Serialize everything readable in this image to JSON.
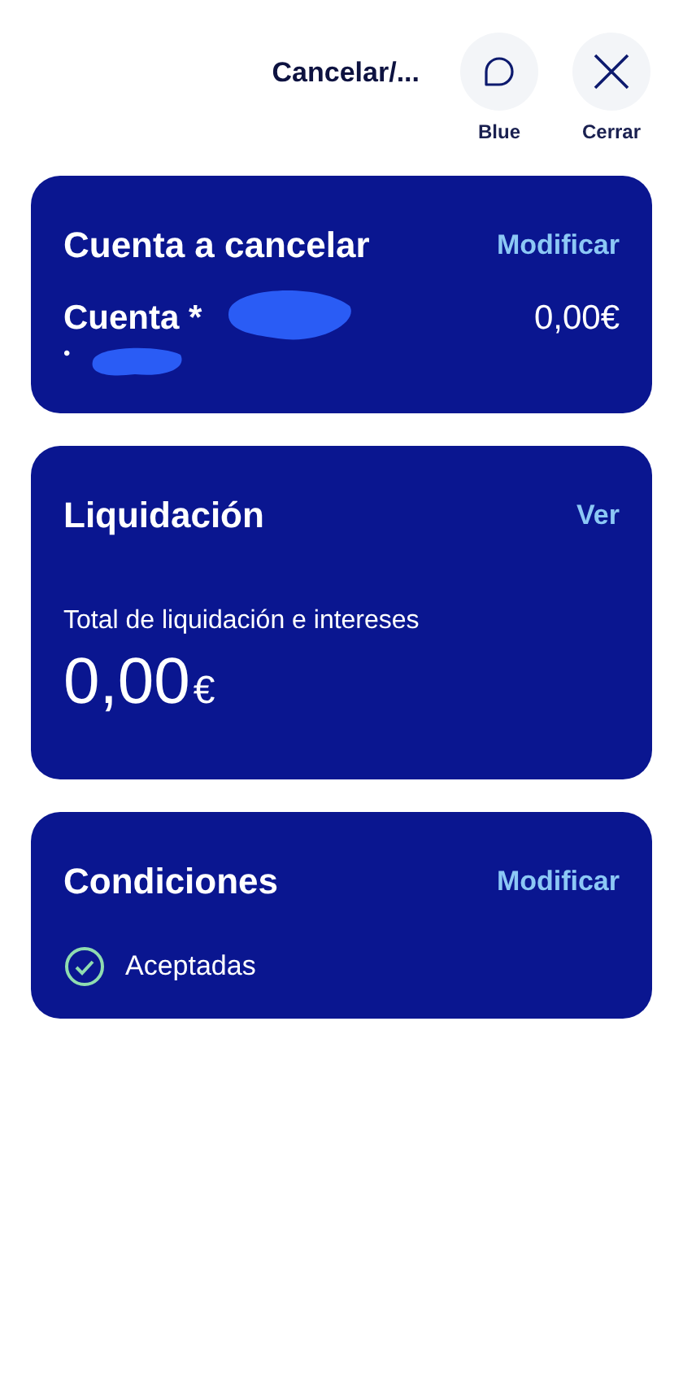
{
  "header": {
    "title": "Cancelar/...",
    "actions": [
      {
        "kind": "chat",
        "label": "Blue"
      },
      {
        "kind": "close",
        "label": "Cerrar"
      }
    ]
  },
  "account_card": {
    "title": "Cuenta a cancelar",
    "action": "Modificar",
    "account_name": "Cuenta *",
    "account_detail": "•",
    "balance": "0,00",
    "currency": "€"
  },
  "settlement_card": {
    "title": "Liquidación",
    "action": "Ver",
    "total_label": "Total de liquidación e intereses",
    "total": "0,00",
    "currency": "€"
  },
  "conditions_card": {
    "title": "Condiciones",
    "action": "Modificar",
    "status": "Aceptadas",
    "accepted": true
  }
}
